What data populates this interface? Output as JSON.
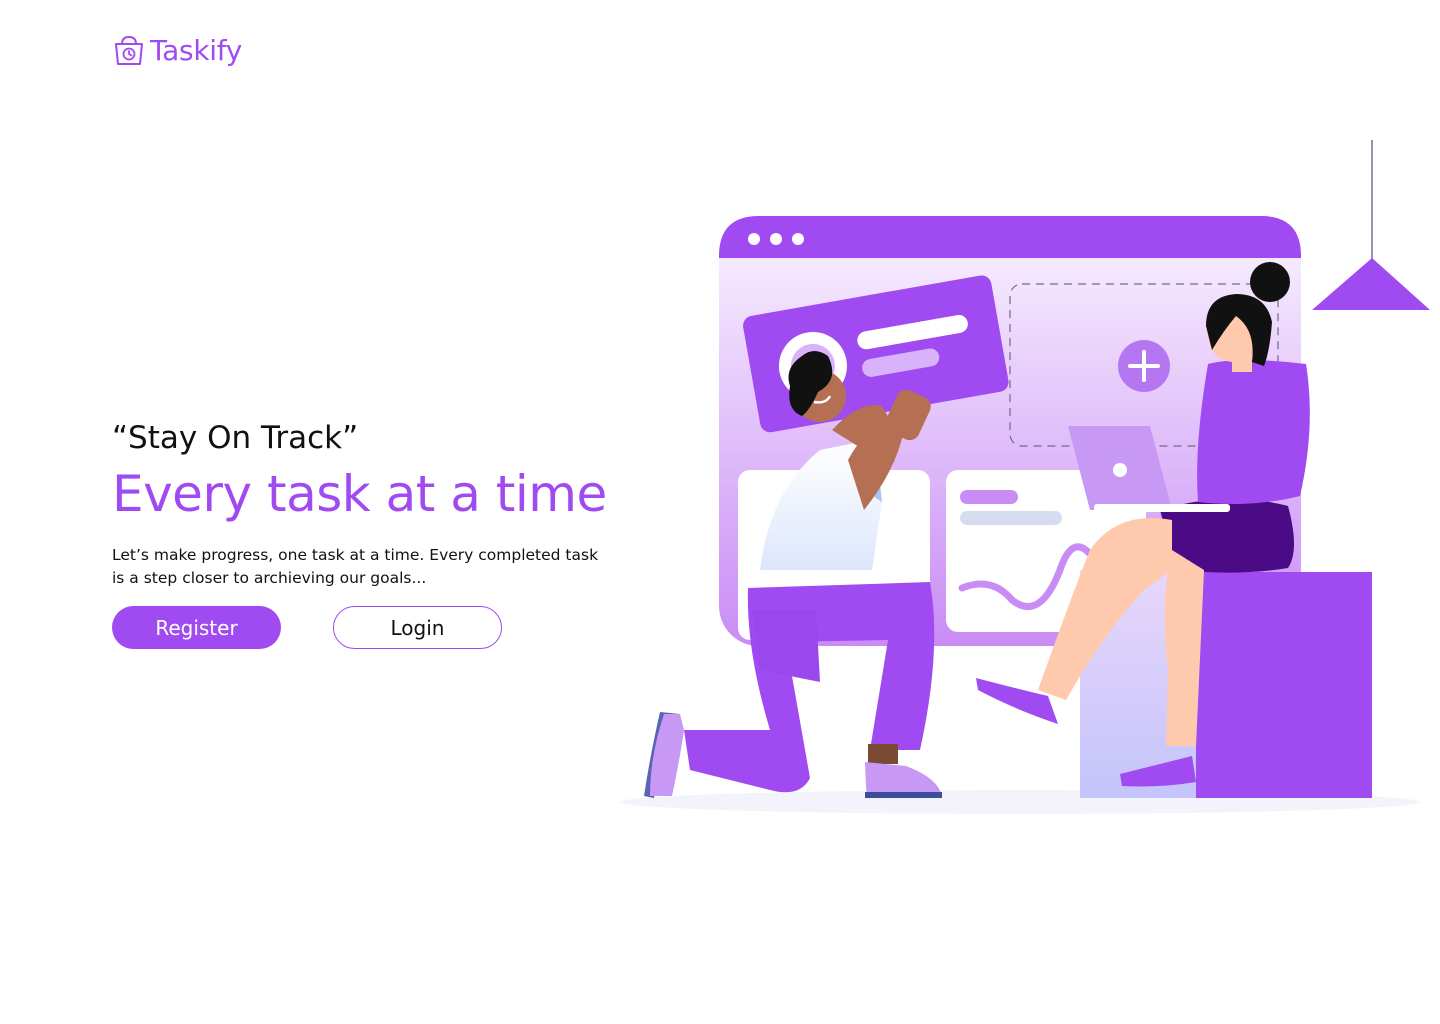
{
  "brand": {
    "name": "Taskify",
    "icon": "shopping-bag-clock-icon",
    "color": "#a04af2"
  },
  "hero": {
    "quote": "“Stay On Track”",
    "headline": "Every task at a time",
    "subtext": "Let’s make progress, one task at a time. Every completed task is  a step closer to archieving our goals..."
  },
  "actions": {
    "register_label": "Register",
    "login_label": "Login"
  },
  "colors": {
    "accent": "#a04af2",
    "accent_light": "#e2c7fb",
    "accent_dark": "#4b0a86"
  }
}
